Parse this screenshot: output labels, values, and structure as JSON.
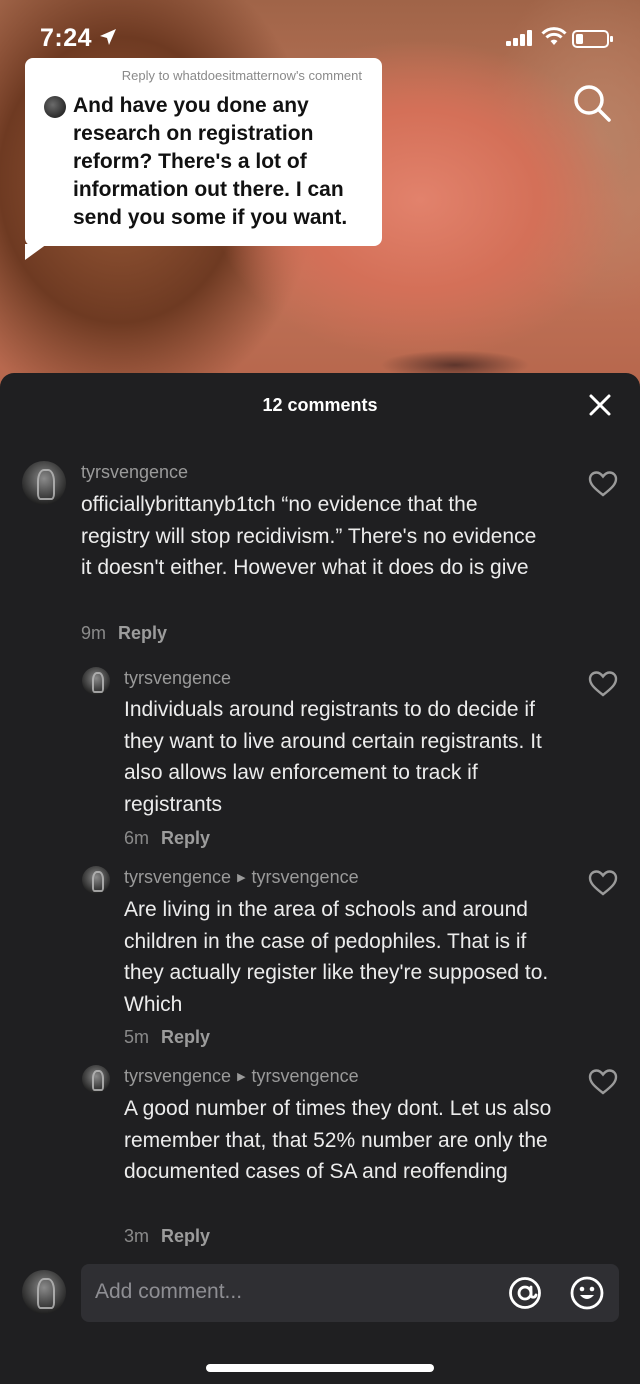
{
  "status_bar": {
    "time": "7:24"
  },
  "reply_bubble": {
    "meta": "Reply to whatdoesitmatternow's comment",
    "text": "And have you done any research on registration reform? There's a lot of information out there. I can send you some if you want."
  },
  "sheet": {
    "title": "12 comments"
  },
  "comments": [
    {
      "username": "tyrsvengence",
      "reply_to": "",
      "text": "officiallybrittanyb1tch “no evidence that the registry will stop recidivism.” There's no evidence it doesn't either. However what it does do is give",
      "time": "9m",
      "reply_label": "Reply"
    },
    {
      "username": "tyrsvengence",
      "reply_to": "",
      "text": "Individuals around registrants to do decide if they want to live around certain registrants. It also allows law enforcement to track if registrants",
      "time": "6m",
      "reply_label": "Reply"
    },
    {
      "username": "tyrsvengence",
      "reply_to": "tyrsvengence",
      "text": "Are living in the area of schools and around children in the case of pedophiles. That is if they actually register like they're supposed to. Which",
      "time": "5m",
      "reply_label": "Reply"
    },
    {
      "username": "tyrsvengence",
      "reply_to": "tyrsvengence",
      "text": "A good number of times they dont. Let us also remember that, that 52% number are only the documented cases of SA and reoffending",
      "time": "3m",
      "reply_label": "Reply"
    }
  ],
  "input": {
    "placeholder": "Add comment..."
  },
  "colors": {
    "sheet_bg": "#1f1f21",
    "input_bg": "#2f2f33",
    "text_primary": "#ececec",
    "text_secondary": "#9a9a9a"
  }
}
